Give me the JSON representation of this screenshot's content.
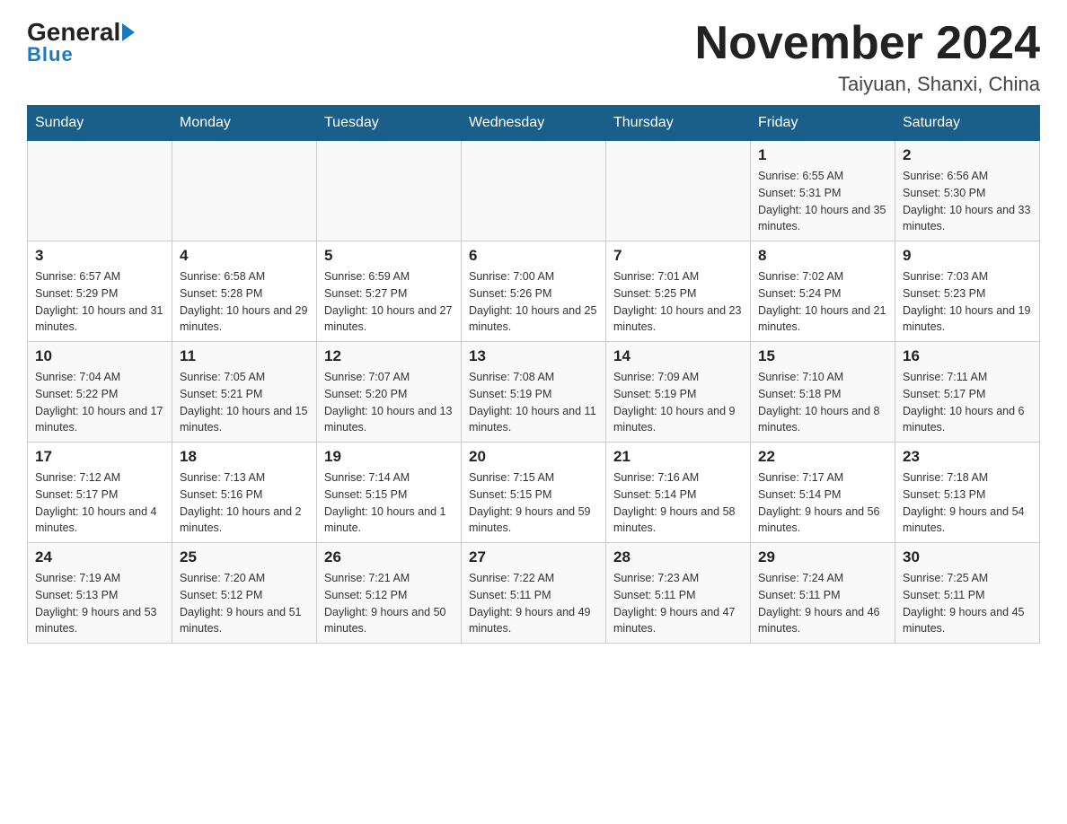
{
  "header": {
    "logo_general": "General",
    "logo_blue": "Blue",
    "month_title": "November 2024",
    "location": "Taiyuan, Shanxi, China"
  },
  "days_of_week": [
    "Sunday",
    "Monday",
    "Tuesday",
    "Wednesday",
    "Thursday",
    "Friday",
    "Saturday"
  ],
  "weeks": [
    {
      "days": [
        {
          "number": "",
          "sunrise": "",
          "sunset": "",
          "daylight": "",
          "empty": true
        },
        {
          "number": "",
          "sunrise": "",
          "sunset": "",
          "daylight": "",
          "empty": true
        },
        {
          "number": "",
          "sunrise": "",
          "sunset": "",
          "daylight": "",
          "empty": true
        },
        {
          "number": "",
          "sunrise": "",
          "sunset": "",
          "daylight": "",
          "empty": true
        },
        {
          "number": "",
          "sunrise": "",
          "sunset": "",
          "daylight": "",
          "empty": true
        },
        {
          "number": "1",
          "sunrise": "Sunrise: 6:55 AM",
          "sunset": "Sunset: 5:31 PM",
          "daylight": "Daylight: 10 hours and 35 minutes.",
          "empty": false
        },
        {
          "number": "2",
          "sunrise": "Sunrise: 6:56 AM",
          "sunset": "Sunset: 5:30 PM",
          "daylight": "Daylight: 10 hours and 33 minutes.",
          "empty": false
        }
      ]
    },
    {
      "days": [
        {
          "number": "3",
          "sunrise": "Sunrise: 6:57 AM",
          "sunset": "Sunset: 5:29 PM",
          "daylight": "Daylight: 10 hours and 31 minutes.",
          "empty": false
        },
        {
          "number": "4",
          "sunrise": "Sunrise: 6:58 AM",
          "sunset": "Sunset: 5:28 PM",
          "daylight": "Daylight: 10 hours and 29 minutes.",
          "empty": false
        },
        {
          "number": "5",
          "sunrise": "Sunrise: 6:59 AM",
          "sunset": "Sunset: 5:27 PM",
          "daylight": "Daylight: 10 hours and 27 minutes.",
          "empty": false
        },
        {
          "number": "6",
          "sunrise": "Sunrise: 7:00 AM",
          "sunset": "Sunset: 5:26 PM",
          "daylight": "Daylight: 10 hours and 25 minutes.",
          "empty": false
        },
        {
          "number": "7",
          "sunrise": "Sunrise: 7:01 AM",
          "sunset": "Sunset: 5:25 PM",
          "daylight": "Daylight: 10 hours and 23 minutes.",
          "empty": false
        },
        {
          "number": "8",
          "sunrise": "Sunrise: 7:02 AM",
          "sunset": "Sunset: 5:24 PM",
          "daylight": "Daylight: 10 hours and 21 minutes.",
          "empty": false
        },
        {
          "number": "9",
          "sunrise": "Sunrise: 7:03 AM",
          "sunset": "Sunset: 5:23 PM",
          "daylight": "Daylight: 10 hours and 19 minutes.",
          "empty": false
        }
      ]
    },
    {
      "days": [
        {
          "number": "10",
          "sunrise": "Sunrise: 7:04 AM",
          "sunset": "Sunset: 5:22 PM",
          "daylight": "Daylight: 10 hours and 17 minutes.",
          "empty": false
        },
        {
          "number": "11",
          "sunrise": "Sunrise: 7:05 AM",
          "sunset": "Sunset: 5:21 PM",
          "daylight": "Daylight: 10 hours and 15 minutes.",
          "empty": false
        },
        {
          "number": "12",
          "sunrise": "Sunrise: 7:07 AM",
          "sunset": "Sunset: 5:20 PM",
          "daylight": "Daylight: 10 hours and 13 minutes.",
          "empty": false
        },
        {
          "number": "13",
          "sunrise": "Sunrise: 7:08 AM",
          "sunset": "Sunset: 5:19 PM",
          "daylight": "Daylight: 10 hours and 11 minutes.",
          "empty": false
        },
        {
          "number": "14",
          "sunrise": "Sunrise: 7:09 AM",
          "sunset": "Sunset: 5:19 PM",
          "daylight": "Daylight: 10 hours and 9 minutes.",
          "empty": false
        },
        {
          "number": "15",
          "sunrise": "Sunrise: 7:10 AM",
          "sunset": "Sunset: 5:18 PM",
          "daylight": "Daylight: 10 hours and 8 minutes.",
          "empty": false
        },
        {
          "number": "16",
          "sunrise": "Sunrise: 7:11 AM",
          "sunset": "Sunset: 5:17 PM",
          "daylight": "Daylight: 10 hours and 6 minutes.",
          "empty": false
        }
      ]
    },
    {
      "days": [
        {
          "number": "17",
          "sunrise": "Sunrise: 7:12 AM",
          "sunset": "Sunset: 5:17 PM",
          "daylight": "Daylight: 10 hours and 4 minutes.",
          "empty": false
        },
        {
          "number": "18",
          "sunrise": "Sunrise: 7:13 AM",
          "sunset": "Sunset: 5:16 PM",
          "daylight": "Daylight: 10 hours and 2 minutes.",
          "empty": false
        },
        {
          "number": "19",
          "sunrise": "Sunrise: 7:14 AM",
          "sunset": "Sunset: 5:15 PM",
          "daylight": "Daylight: 10 hours and 1 minute.",
          "empty": false
        },
        {
          "number": "20",
          "sunrise": "Sunrise: 7:15 AM",
          "sunset": "Sunset: 5:15 PM",
          "daylight": "Daylight: 9 hours and 59 minutes.",
          "empty": false
        },
        {
          "number": "21",
          "sunrise": "Sunrise: 7:16 AM",
          "sunset": "Sunset: 5:14 PM",
          "daylight": "Daylight: 9 hours and 58 minutes.",
          "empty": false
        },
        {
          "number": "22",
          "sunrise": "Sunrise: 7:17 AM",
          "sunset": "Sunset: 5:14 PM",
          "daylight": "Daylight: 9 hours and 56 minutes.",
          "empty": false
        },
        {
          "number": "23",
          "sunrise": "Sunrise: 7:18 AM",
          "sunset": "Sunset: 5:13 PM",
          "daylight": "Daylight: 9 hours and 54 minutes.",
          "empty": false
        }
      ]
    },
    {
      "days": [
        {
          "number": "24",
          "sunrise": "Sunrise: 7:19 AM",
          "sunset": "Sunset: 5:13 PM",
          "daylight": "Daylight: 9 hours and 53 minutes.",
          "empty": false
        },
        {
          "number": "25",
          "sunrise": "Sunrise: 7:20 AM",
          "sunset": "Sunset: 5:12 PM",
          "daylight": "Daylight: 9 hours and 51 minutes.",
          "empty": false
        },
        {
          "number": "26",
          "sunrise": "Sunrise: 7:21 AM",
          "sunset": "Sunset: 5:12 PM",
          "daylight": "Daylight: 9 hours and 50 minutes.",
          "empty": false
        },
        {
          "number": "27",
          "sunrise": "Sunrise: 7:22 AM",
          "sunset": "Sunset: 5:11 PM",
          "daylight": "Daylight: 9 hours and 49 minutes.",
          "empty": false
        },
        {
          "number": "28",
          "sunrise": "Sunrise: 7:23 AM",
          "sunset": "Sunset: 5:11 PM",
          "daylight": "Daylight: 9 hours and 47 minutes.",
          "empty": false
        },
        {
          "number": "29",
          "sunrise": "Sunrise: 7:24 AM",
          "sunset": "Sunset: 5:11 PM",
          "daylight": "Daylight: 9 hours and 46 minutes.",
          "empty": false
        },
        {
          "number": "30",
          "sunrise": "Sunrise: 7:25 AM",
          "sunset": "Sunset: 5:11 PM",
          "daylight": "Daylight: 9 hours and 45 minutes.",
          "empty": false
        }
      ]
    }
  ]
}
